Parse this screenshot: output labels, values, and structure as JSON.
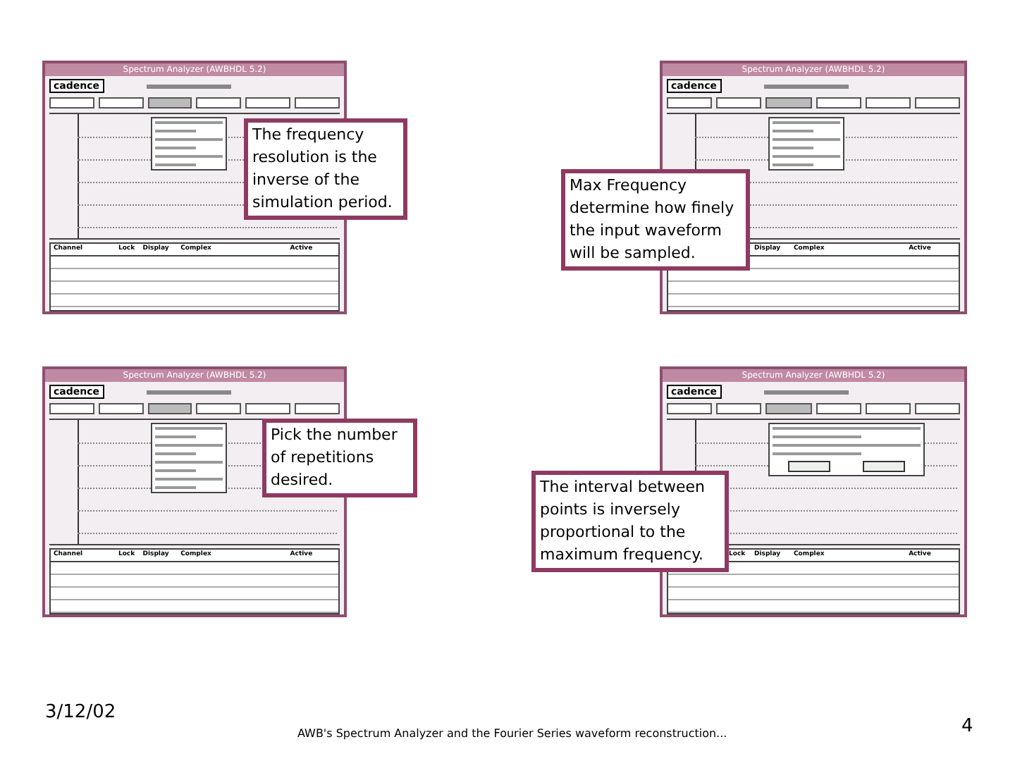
{
  "panels": [
    {
      "window": {
        "title": "Spectrum Analyzer (AWBHDL 5.2)",
        "logo": "cadence"
      },
      "table_columns": [
        "Channel",
        "Lock",
        "Display",
        "Complex",
        "Active"
      ],
      "popup": {
        "kind": "menu"
      },
      "callout": "The frequency resolution is the inverse of the simulation period."
    },
    {
      "window": {
        "title": "Spectrum Analyzer (AWBHDL 5.2)",
        "logo": "cadence"
      },
      "table_columns": [
        "Display",
        "Complex",
        "Active"
      ],
      "popup": {
        "kind": "menu"
      },
      "callout": "Max Frequency determine how finely the input waveform will be sampled."
    },
    {
      "window": {
        "title": "Spectrum Analyzer (AWBHDL 5.2)",
        "logo": "cadence"
      },
      "table_columns": [
        "Channel",
        "Lock",
        "Display",
        "Complex",
        "Active"
      ],
      "popup": {
        "kind": "list"
      },
      "callout": "Pick the number of repetitions desired."
    },
    {
      "window": {
        "title": "Spectrum Analyzer (AWBHDL 5.2)",
        "logo": "cadence"
      },
      "table_columns": [
        "Lock",
        "Display",
        "Complex",
        "Active"
      ],
      "popup": {
        "kind": "dialog"
      },
      "callout": "The interval between points is inversely proportional to the maximum frequency."
    }
  ],
  "footer": {
    "date": "3/12/02",
    "caption": "AWB's Spectrum Analyzer and the Fourier Series waveform reconstruction...",
    "page": "4"
  }
}
